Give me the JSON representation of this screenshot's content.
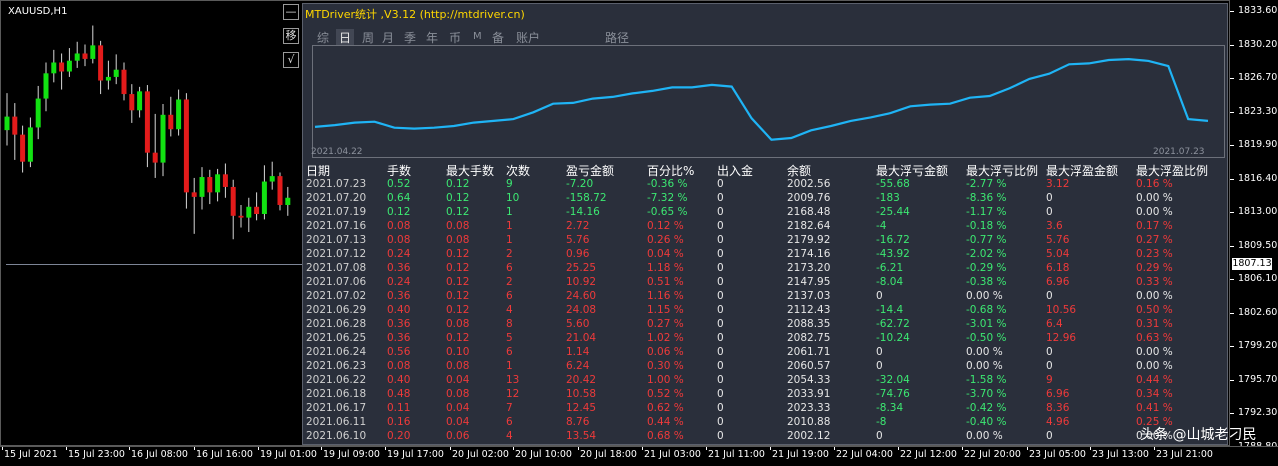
{
  "symbol": "XAUUSD,H1",
  "panel_title": "MTDriver统计 ,V3.12 (http://mtdriver.cn)",
  "buttons": {
    "minimize": "—",
    "move": "移",
    "confirm": "√"
  },
  "tabs": [
    {
      "label": "综",
      "active": false
    },
    {
      "label": "日",
      "active": true
    },
    {
      "label": "周",
      "active": false
    },
    {
      "label": "月",
      "active": false
    },
    {
      "label": "季",
      "active": false
    },
    {
      "label": "年",
      "active": false
    },
    {
      "label": "币",
      "active": false
    },
    {
      "label": "M",
      "active": false
    },
    {
      "label": "备",
      "active": false
    },
    {
      "label": "账户",
      "active": false
    },
    {
      "label": "路径",
      "active": false
    }
  ],
  "mini_chart": {
    "start_date": "2021.04.22",
    "end_date": "2021.07.23",
    "color": "#1fb4f5",
    "values": [
      0.05,
      0.07,
      0.1,
      0.11,
      0.04,
      0.03,
      0.04,
      0.06,
      0.1,
      0.12,
      0.14,
      0.22,
      0.32,
      0.33,
      0.38,
      0.4,
      0.44,
      0.47,
      0.51,
      0.51,
      0.54,
      0.52,
      0.15,
      -0.1,
      -0.08,
      0.01,
      0.06,
      0.12,
      0.16,
      0.21,
      0.29,
      0.31,
      0.32,
      0.39,
      0.41,
      0.5,
      0.61,
      0.67,
      0.78,
      0.79,
      0.83,
      0.84,
      0.82,
      0.76,
      0.14,
      0.12
    ]
  },
  "price_axis": {
    "ticks": [
      "1833.60",
      "1830.20",
      "1826.70",
      "1823.30",
      "1819.90",
      "1816.40",
      "1813.00",
      "1809.50",
      "1806.10",
      "1802.60",
      "1799.20",
      "1795.70",
      "1792.30",
      "1788.80"
    ],
    "current": "1807.13"
  },
  "time_axis": {
    "ticks": [
      "15 Jul 2021",
      "15 Jul 23:00",
      "16 Jul 08:00",
      "16 Jul 16:00",
      "19 Jul 01:00",
      "19 Jul 09:00",
      "19 Jul 17:00",
      "20 Jul 02:00",
      "20 Jul 10:00",
      "20 Jul 18:00",
      "21 Jul 03:00",
      "21 Jul 11:00",
      "21 Jul 19:00",
      "22 Jul 04:00",
      "22 Jul 12:00",
      "22 Jul 20:00",
      "23 Jul 05:00",
      "23 Jul 13:00",
      "23 Jul 21:00"
    ]
  },
  "table": {
    "headers": [
      "日期",
      "手数",
      "最大手数",
      "次数",
      "盈亏金额",
      "百分比%",
      "出入金",
      "余额",
      "最大浮亏金额",
      "最大浮亏比例",
      "最大浮盈金额",
      "最大浮盈比例"
    ],
    "rows": [
      {
        "tone": "green",
        "cells": [
          "2021.07.23",
          "0.52",
          "0.12",
          "9",
          "-7.20",
          "-0.36 %",
          "0",
          "2002.56",
          "-55.68",
          "-2.77 %",
          "3.12",
          "0.16 %"
        ]
      },
      {
        "tone": "green",
        "cells": [
          "2021.07.20",
          "0.64",
          "0.12",
          "10",
          "-158.72",
          "-7.32 %",
          "0",
          "2009.76",
          "-183",
          "-8.36 %",
          "0",
          "0.00 %"
        ]
      },
      {
        "tone": "green",
        "cells": [
          "2021.07.19",
          "0.12",
          "0.12",
          "1",
          "-14.16",
          "-0.65 %",
          "0",
          "2168.48",
          "-25.44",
          "-1.17 %",
          "0",
          "0.00 %"
        ]
      },
      {
        "tone": "red",
        "cells": [
          "2021.07.16",
          "0.08",
          "0.08",
          "1",
          "2.72",
          "0.12 %",
          "0",
          "2182.64",
          "-4",
          "-0.18 %",
          "3.6",
          "0.17 %"
        ]
      },
      {
        "tone": "red",
        "cells": [
          "2021.07.13",
          "0.08",
          "0.08",
          "1",
          "5.76",
          "0.26 %",
          "0",
          "2179.92",
          "-16.72",
          "-0.77 %",
          "5.76",
          "0.27 %"
        ]
      },
      {
        "tone": "red",
        "cells": [
          "2021.07.12",
          "0.24",
          "0.12",
          "2",
          "0.96",
          "0.04 %",
          "0",
          "2174.16",
          "-43.92",
          "-2.02 %",
          "5.04",
          "0.23 %"
        ]
      },
      {
        "tone": "red",
        "cells": [
          "2021.07.08",
          "0.36",
          "0.12",
          "6",
          "25.25",
          "1.18 %",
          "0",
          "2173.20",
          "-6.21",
          "-0.29 %",
          "6.18",
          "0.29 %"
        ]
      },
      {
        "tone": "red",
        "cells": [
          "2021.07.06",
          "0.24",
          "0.12",
          "2",
          "10.92",
          "0.51 %",
          "0",
          "2147.95",
          "-8.04",
          "-0.38 %",
          "6.96",
          "0.33 %"
        ]
      },
      {
        "tone": "red",
        "cells": [
          "2021.07.02",
          "0.36",
          "0.12",
          "6",
          "24.60",
          "1.16 %",
          "0",
          "2137.03",
          "0",
          "0.00 %",
          "0",
          "0.00 %"
        ]
      },
      {
        "tone": "red",
        "cells": [
          "2021.06.29",
          "0.40",
          "0.12",
          "4",
          "24.08",
          "1.15 %",
          "0",
          "2112.43",
          "-14.4",
          "-0.68 %",
          "10.56",
          "0.50 %"
        ]
      },
      {
        "tone": "red",
        "cells": [
          "2021.06.28",
          "0.36",
          "0.08",
          "8",
          "5.60",
          "0.27 %",
          "0",
          "2088.35",
          "-62.72",
          "-3.01 %",
          "6.4",
          "0.31 %"
        ]
      },
      {
        "tone": "red",
        "cells": [
          "2021.06.25",
          "0.36",
          "0.12",
          "5",
          "21.04",
          "1.02 %",
          "0",
          "2082.75",
          "-10.24",
          "-0.50 %",
          "12.96",
          "0.63 %"
        ]
      },
      {
        "tone": "red",
        "cells": [
          "2021.06.24",
          "0.56",
          "0.10",
          "6",
          "1.14",
          "0.06 %",
          "0",
          "2061.71",
          "0",
          "0.00 %",
          "0",
          "0.00 %"
        ]
      },
      {
        "tone": "red",
        "cells": [
          "2021.06.23",
          "0.08",
          "0.08",
          "1",
          "6.24",
          "0.30 %",
          "0",
          "2060.57",
          "0",
          "0.00 %",
          "0",
          "0.00 %"
        ]
      },
      {
        "tone": "red",
        "cells": [
          "2021.06.22",
          "0.40",
          "0.04",
          "13",
          "20.42",
          "1.00 %",
          "0",
          "2054.33",
          "-32.04",
          "-1.58 %",
          "9",
          "0.44 %"
        ]
      },
      {
        "tone": "red",
        "cells": [
          "2021.06.18",
          "0.48",
          "0.08",
          "12",
          "10.58",
          "0.52 %",
          "0",
          "2033.91",
          "-74.76",
          "-3.70 %",
          "6.96",
          "0.34 %"
        ]
      },
      {
        "tone": "red",
        "cells": [
          "2021.06.17",
          "0.11",
          "0.04",
          "7",
          "12.45",
          "0.62 %",
          "0",
          "2023.33",
          "-8.34",
          "-0.42 %",
          "8.36",
          "0.41 %"
        ]
      },
      {
        "tone": "red",
        "cells": [
          "2021.06.11",
          "0.16",
          "0.04",
          "6",
          "8.76",
          "0.44 %",
          "0",
          "2010.88",
          "-8",
          "-0.40 %",
          "4.96",
          "0.25 %"
        ]
      },
      {
        "tone": "red",
        "cells": [
          "2021.06.10",
          "0.20",
          "0.06",
          "4",
          "13.54",
          "0.68 %",
          "0",
          "2002.12",
          "0",
          "0.00 %",
          "0",
          "0.00 %"
        ]
      }
    ]
  },
  "candles": [
    {
      "o": 1820.5,
      "c": 1822.0,
      "h": 1824.6,
      "l": 1818.8
    },
    {
      "o": 1822.0,
      "c": 1820.0,
      "h": 1823.5,
      "l": 1817.2
    },
    {
      "o": 1820.0,
      "c": 1817.0,
      "h": 1821.0,
      "l": 1815.8
    },
    {
      "o": 1817.0,
      "c": 1820.8,
      "h": 1821.9,
      "l": 1816.4
    },
    {
      "o": 1820.8,
      "c": 1824.0,
      "h": 1825.4,
      "l": 1819.5
    },
    {
      "o": 1824.0,
      "c": 1826.8,
      "h": 1828.0,
      "l": 1822.6
    },
    {
      "o": 1826.8,
      "c": 1828.0,
      "h": 1829.4,
      "l": 1825.8
    },
    {
      "o": 1828.0,
      "c": 1827.0,
      "h": 1829.0,
      "l": 1825.0
    },
    {
      "o": 1827.0,
      "c": 1828.2,
      "h": 1829.6,
      "l": 1826.4
    },
    {
      "o": 1828.2,
      "c": 1829.0,
      "h": 1830.3,
      "l": 1827.4
    },
    {
      "o": 1829.0,
      "c": 1828.4,
      "h": 1830.0,
      "l": 1827.6
    },
    {
      "o": 1828.4,
      "c": 1829.9,
      "h": 1832.1,
      "l": 1827.9
    },
    {
      "o": 1829.9,
      "c": 1826.0,
      "h": 1830.4,
      "l": 1824.5
    },
    {
      "o": 1826.0,
      "c": 1826.4,
      "h": 1828.2,
      "l": 1825.0
    },
    {
      "o": 1826.4,
      "c": 1827.2,
      "h": 1828.9,
      "l": 1825.6
    },
    {
      "o": 1827.2,
      "c": 1824.5,
      "h": 1828.0,
      "l": 1823.8
    },
    {
      "o": 1824.5,
      "c": 1822.7,
      "h": 1825.6,
      "l": 1821.3
    },
    {
      "o": 1822.7,
      "c": 1824.8,
      "h": 1825.3,
      "l": 1821.9
    },
    {
      "o": 1824.8,
      "c": 1818.0,
      "h": 1825.5,
      "l": 1816.4
    },
    {
      "o": 1818.0,
      "c": 1816.9,
      "h": 1822.3,
      "l": 1815.2
    },
    {
      "o": 1816.9,
      "c": 1822.2,
      "h": 1823.4,
      "l": 1815.4
    },
    {
      "o": 1822.2,
      "c": 1820.6,
      "h": 1824.2,
      "l": 1819.8
    },
    {
      "o": 1820.6,
      "c": 1823.9,
      "h": 1825.0,
      "l": 1819.9
    },
    {
      "o": 1823.9,
      "c": 1813.6,
      "h": 1824.6,
      "l": 1811.8
    },
    {
      "o": 1813.6,
      "c": 1813.1,
      "h": 1815.2,
      "l": 1809.0
    },
    {
      "o": 1813.1,
      "c": 1815.3,
      "h": 1816.4,
      "l": 1811.7
    },
    {
      "o": 1815.3,
      "c": 1813.6,
      "h": 1816.1,
      "l": 1812.3
    },
    {
      "o": 1813.6,
      "c": 1815.6,
      "h": 1816.2,
      "l": 1812.6
    },
    {
      "o": 1815.6,
      "c": 1814.2,
      "h": 1816.8,
      "l": 1813.0
    },
    {
      "o": 1814.2,
      "c": 1811.0,
      "h": 1815.0,
      "l": 1808.4
    },
    {
      "o": 1811.0,
      "c": 1810.8,
      "h": 1812.2,
      "l": 1809.7
    },
    {
      "o": 1810.8,
      "c": 1812.0,
      "h": 1813.0,
      "l": 1809.2
    },
    {
      "o": 1812.0,
      "c": 1811.2,
      "h": 1813.6,
      "l": 1810.5
    },
    {
      "o": 1811.2,
      "c": 1814.8,
      "h": 1816.6,
      "l": 1810.6
    },
    {
      "o": 1814.8,
      "c": 1815.4,
      "h": 1817.0,
      "l": 1813.9
    },
    {
      "o": 1815.4,
      "c": 1812.2,
      "h": 1815.8,
      "l": 1811.6
    },
    {
      "o": 1812.2,
      "c": 1813.0,
      "h": 1814.2,
      "l": 1811.0
    }
  ],
  "watermark": "头条 @山城老刁民"
}
